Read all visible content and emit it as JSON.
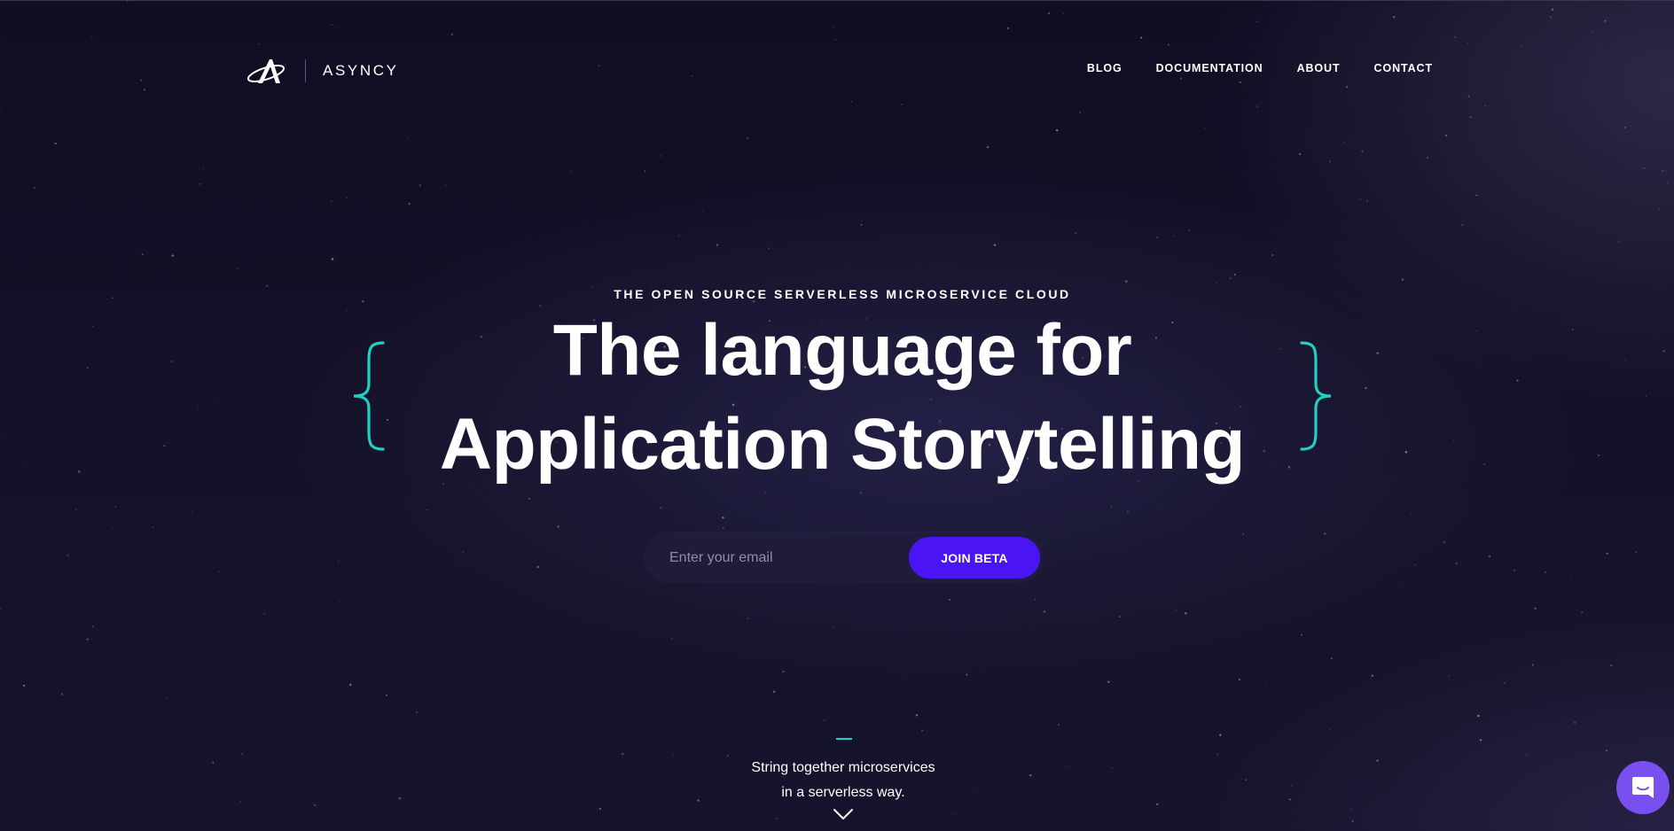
{
  "brand": {
    "name": "ASYNCY",
    "logo_icon": "asyncy-logo-icon"
  },
  "nav": {
    "items": [
      {
        "label": "BLOG"
      },
      {
        "label": "DOCUMENTATION"
      },
      {
        "label": "ABOUT"
      },
      {
        "label": "CONTACT"
      }
    ]
  },
  "hero": {
    "eyebrow": "THE OPEN SOURCE SERVERLESS MICROSERVICE CLOUD",
    "headline_line1": "The language for",
    "headline_line2": "Application Storytelling",
    "brace_color": "#22cfc0"
  },
  "signup": {
    "email_placeholder": "Enter your email",
    "email_value": "",
    "button_label": "JOIN BETA",
    "button_color": "#4a14f5"
  },
  "footer_teaser": {
    "line1": "String together microservices",
    "line2": "in a serverless way.",
    "scroll_icon": "chevron-down-icon"
  },
  "chat": {
    "icon": "chat-launcher-icon",
    "color": "#7a4ff0"
  }
}
